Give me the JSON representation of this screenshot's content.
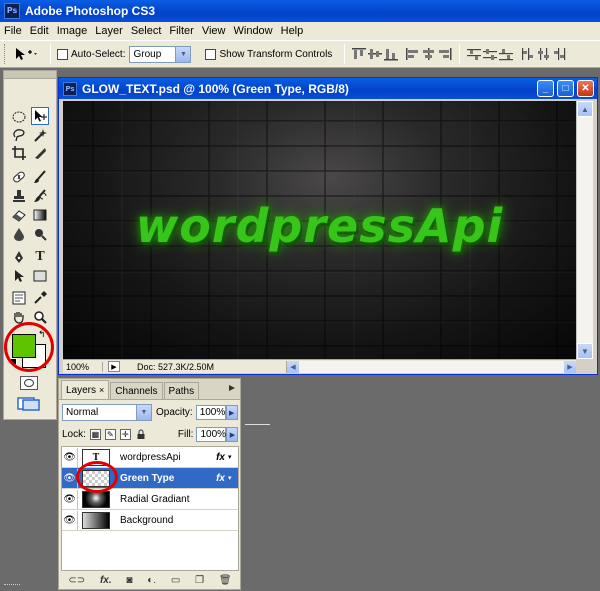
{
  "app": {
    "title": "Adobe Photoshop CS3",
    "icon": "Ps"
  },
  "menu": [
    "File",
    "Edit",
    "Image",
    "Layer",
    "Select",
    "Filter",
    "View",
    "Window",
    "Help"
  ],
  "options": {
    "auto_select_label": "Auto-Select:",
    "auto_select_value": "Group",
    "show_transform_label": "Show Transform Controls"
  },
  "document": {
    "title": "GLOW_TEXT.psd @ 100% (Green Type, RGB/8)",
    "canvas_text": "wordpressApi",
    "zoom": "100%",
    "doc_info": "Doc: 527.3K/2.50M"
  },
  "colors": {
    "foreground": "#5ec400",
    "background": "#ffffff",
    "glow": "#37c51a",
    "highlight": "#e00000"
  },
  "layers_panel": {
    "tabs": [
      {
        "label": "Layers",
        "close": "×"
      },
      {
        "label": "Channels"
      },
      {
        "label": "Paths"
      }
    ],
    "blend_mode": "Normal",
    "opacity_label": "Opacity:",
    "opacity_value": "100%",
    "lock_label": "Lock:",
    "fill_label": "Fill:",
    "fill_value": "100%",
    "layers": [
      {
        "name": "wordpressApi",
        "thumb": "T",
        "fx": "fx"
      },
      {
        "name": "Green Type",
        "fx": "fx",
        "selected": true
      },
      {
        "name": "Radial Gradiant"
      },
      {
        "name": "Background"
      }
    ]
  }
}
